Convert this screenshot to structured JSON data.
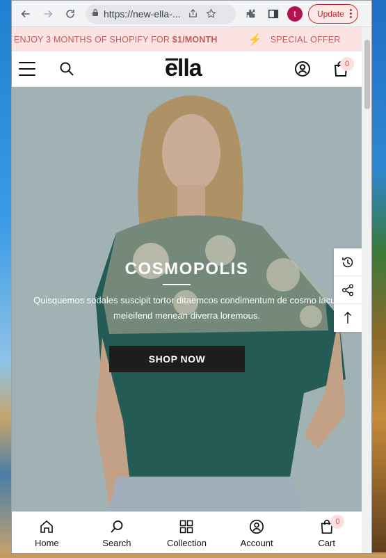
{
  "browser": {
    "url": "https://new-ella-...",
    "profile_initial": "t",
    "update_label": "Update",
    "colors": {
      "update": "#c5221f",
      "profile": "#b0134f"
    }
  },
  "announcement": {
    "text_prefix": "ENJOY 3 MONTHS OF SHOPIFY FOR ",
    "text_bold": "$1/MONTH",
    "text_2": "SPECIAL OFFER",
    "icon": "bolt-icon",
    "colors": {
      "bg": "#fbe3e4",
      "text": "#c05d5a"
    }
  },
  "header": {
    "logo": "ella",
    "cart_count": "0",
    "icons": [
      "menu-icon",
      "search-icon",
      "account-icon",
      "cart-icon"
    ]
  },
  "hero": {
    "title": "COSMOPOLIS",
    "text": "Quisquemos sodales suscipit tortor ditaemcos condimentum de cosmo lacus meleifend menean diverra loremous.",
    "button_label": "SHOP NOW"
  },
  "side_tools": [
    "recently-viewed-icon",
    "share-icon",
    "back-to-top-icon"
  ],
  "bottom_nav": {
    "items": [
      {
        "label": "Home",
        "icon": "home-icon"
      },
      {
        "label": "Search",
        "icon": "search-icon"
      },
      {
        "label": "Collection",
        "icon": "grid-icon"
      },
      {
        "label": "Account",
        "icon": "account-icon"
      },
      {
        "label": "Cart",
        "icon": "cart-icon"
      }
    ],
    "cart_count": "0"
  }
}
